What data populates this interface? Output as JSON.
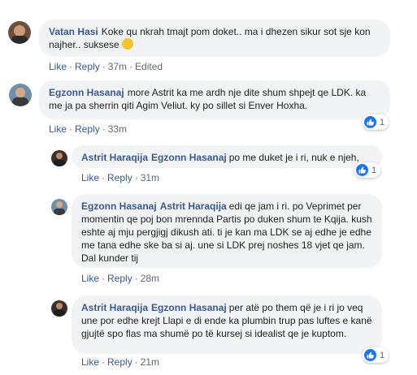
{
  "comments": [
    {
      "author": "Vatan Hasi",
      "mention": "",
      "text": "Koke qu nkrah tmajt pom doket.. ma i dhezen sikur sot sje kon najher.. suksese",
      "emoji": "clapping-hands",
      "like_label": "Like",
      "reply_label": "Reply",
      "time": "37m",
      "edited": "Edited",
      "reactions": ""
    },
    {
      "author": "Egzonn Hasanaj",
      "mention": "",
      "text": "more Astrit ka me ardh nje dite shum shpejt qe LDK. ka me ja pa sherrin qiti Agim Veliut. ky po sillet si Enver Hoxha.",
      "like_label": "Like",
      "reply_label": "Reply",
      "time": "33m",
      "reactions": "1"
    },
    {
      "author": "Astrit Haraqija",
      "mention": "Egzonn Hasanaj",
      "text": "po me duket je i ri, nuk e njeh,",
      "like_label": "Like",
      "reply_label": "Reply",
      "time": "31m",
      "reactions": "1"
    },
    {
      "author": "Egzonn Hasanaj",
      "mention": "Astrit Haraqija",
      "text": "edi qe jam i ri. po Veprimet per momentin qe poj bon mrennda Partis po duken shum te Kqija. kush eshte aj mju pergjigj dikush ati. ti je kan ma LDK se aj edhe je edhe me tana edhe ske ba si aj. une si LDK prej noshes 18 vjet qe jam. Dal kunder tij",
      "like_label": "Like",
      "reply_label": "Reply",
      "time": "28m",
      "reactions": ""
    },
    {
      "author": "Astrit Haraqija",
      "mention": "Egzonn Hasanaj",
      "text": "per atë po them që je i ri jo veq une por edhe krejt Llapi e di ende ka plumbin trup pas luftes e kanë gjujtë spo flas ma shumë po të kursej si idealist qe je kuptom.",
      "like_label": "Like",
      "reply_label": "Reply",
      "time": "21m",
      "reactions": "1"
    }
  ]
}
